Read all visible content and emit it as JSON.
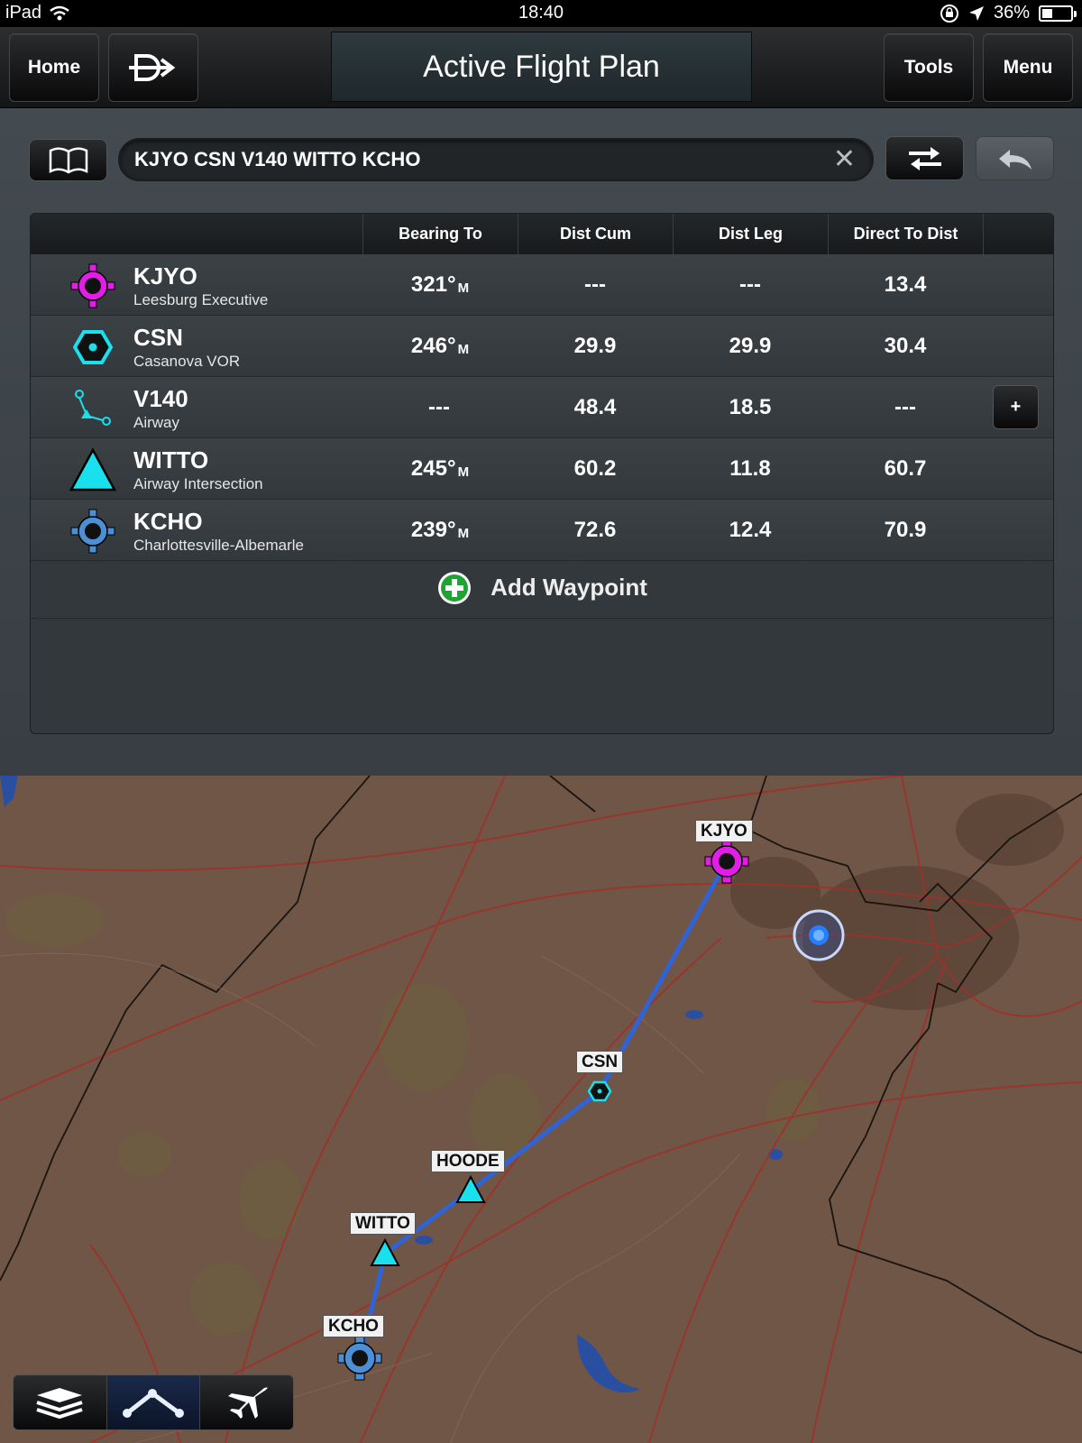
{
  "status": {
    "device": "iPad",
    "time": "18:40",
    "battery": "36%",
    "battery_level": 0.36
  },
  "toolbar": {
    "home_label": "Home",
    "title": "Active Flight Plan",
    "tools_label": "Tools",
    "menu_label": "Menu"
  },
  "route": {
    "value": "KJYO CSN V140 WITTO KCHO",
    "clear_label": "✕"
  },
  "table": {
    "headers": [
      "Bearing To",
      "Dist Cum",
      "Dist Leg",
      "Direct To Dist"
    ],
    "rows": [
      {
        "ident": "KJYO",
        "desc": "Leesburg Executive",
        "bearing": "321°",
        "bearing_unit": "M",
        "dist_cum": "---",
        "dist_leg": "---",
        "direct": "13.4",
        "icon": "airport-magenta-icon"
      },
      {
        "ident": "CSN",
        "desc": "Casanova VOR",
        "bearing": "246°",
        "bearing_unit": "M",
        "dist_cum": "29.9",
        "dist_leg": "29.9",
        "direct": "30.4",
        "icon": "vor-icon"
      },
      {
        "ident": "V140",
        "desc": "Airway",
        "bearing": "---",
        "bearing_unit": "",
        "dist_cum": "48.4",
        "dist_leg": "18.5",
        "direct": "---",
        "icon": "airway-icon"
      },
      {
        "ident": "WITTO",
        "desc": "Airway Intersection",
        "bearing": "245°",
        "bearing_unit": "M",
        "dist_cum": "60.2",
        "dist_leg": "11.8",
        "direct": "60.7",
        "icon": "intersection-icon"
      },
      {
        "ident": "KCHO",
        "desc": "Charlottesville-Albemarle",
        "bearing": "239°",
        "bearing_unit": "M",
        "dist_cum": "72.6",
        "dist_leg": "12.4",
        "direct": "70.9",
        "icon": "airport-blue-icon"
      }
    ],
    "expand_label": "+",
    "add_waypoint_label": "Add Waypoint"
  },
  "map": {
    "labels": {
      "kjyo": "KJYO",
      "csn": "CSN",
      "hoode": "HOODE",
      "witto": "WITTO",
      "kcho": "KCHO"
    }
  },
  "colors": {
    "route_line": "#2f63d6",
    "airport_magenta": "#e21ee6",
    "airport_blue": "#4d8fd4",
    "intersection": "#18e0ec",
    "map_bg": "#6f5646",
    "add_green": "#1fa334"
  }
}
